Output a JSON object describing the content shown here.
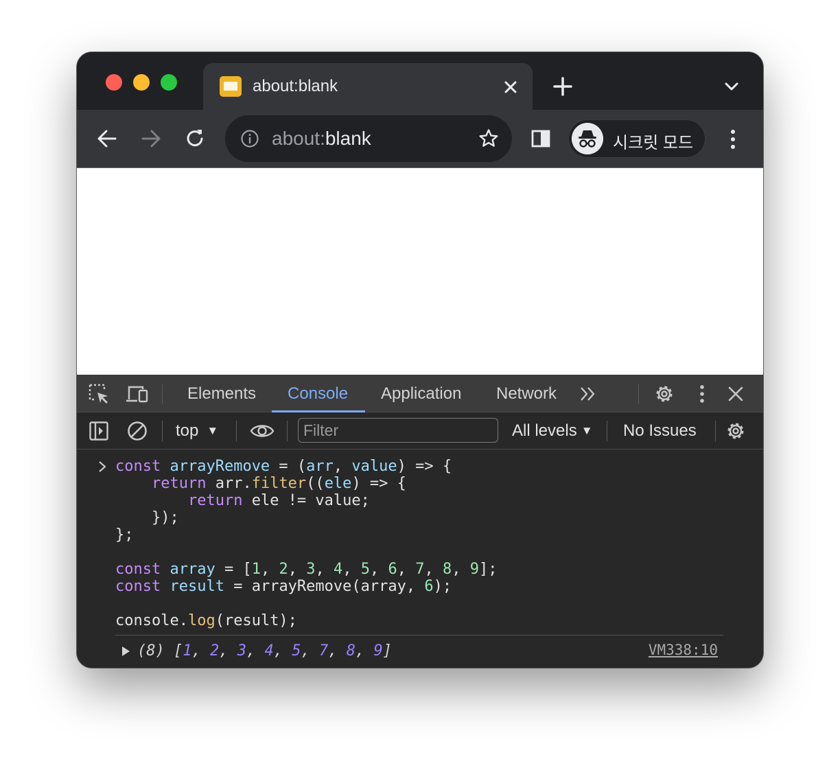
{
  "tab": {
    "title": "about:blank"
  },
  "omnibox": {
    "scheme": "about:",
    "rest": "blank"
  },
  "profile": {
    "label": "시크릿 모드"
  },
  "devtools": {
    "tabs": [
      "Elements",
      "Console",
      "Application",
      "Network"
    ],
    "active_tab": "Console",
    "context": "top",
    "filter_placeholder": "Filter",
    "levels": "All levels",
    "issues": "No Issues"
  },
  "console": {
    "output_text": "(8) [1, 2, 3, 4, 5, 7, 8, 9]",
    "output_length": "(8)",
    "output_values": [
      "1",
      "2",
      "3",
      "4",
      "5",
      "7",
      "8",
      "9"
    ],
    "source_link": "VM338:10"
  },
  "colors": {
    "traffic_red": "#ff5f57",
    "traffic_yellow": "#febc2e",
    "traffic_green": "#28c840",
    "active_tab_accent": "#7cacf8"
  }
}
